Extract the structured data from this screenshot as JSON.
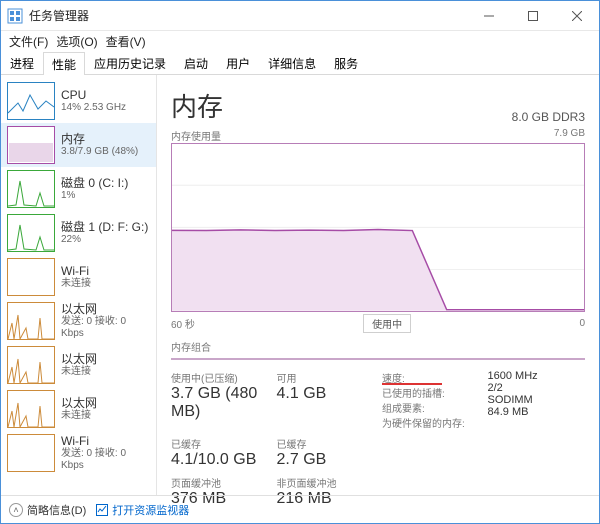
{
  "window": {
    "title": "任务管理器"
  },
  "menu": {
    "file": "文件(F)",
    "options": "选项(O)",
    "view": "查看(V)"
  },
  "tabs": [
    "进程",
    "性能",
    "应用历史记录",
    "启动",
    "用户",
    "详细信息",
    "服务"
  ],
  "active_tab": 1,
  "sidebar": {
    "items": [
      {
        "label": "CPU",
        "sub": "14% 2.53 GHz",
        "kind": "cpu"
      },
      {
        "label": "内存",
        "sub": "3.8/7.9 GB (48%)",
        "kind": "mem"
      },
      {
        "label": "磁盘 0 (C: I:)",
        "sub": "1%",
        "kind": "disk"
      },
      {
        "label": "磁盘 1 (D: F: G:)",
        "sub": "22%",
        "kind": "disk"
      },
      {
        "label": "Wi-Fi",
        "sub": "未连接",
        "kind": "wifi"
      },
      {
        "label": "以太网",
        "sub": "发送: 0 接收: 0 Kbps",
        "kind": "eth"
      },
      {
        "label": "以太网",
        "sub": "未连接",
        "kind": "eth"
      },
      {
        "label": "以太网",
        "sub": "未连接",
        "kind": "eth"
      },
      {
        "label": "Wi-Fi",
        "sub": "发送: 0 接收: 0 Kbps",
        "kind": "wifi"
      }
    ],
    "selected": 1
  },
  "memory": {
    "title": "内存",
    "total": "8.0 GB DDR3",
    "chart_title": "内存使用量",
    "chart_max": "7.9 GB",
    "time_label": "60 秒",
    "zero_label": "0",
    "mid_label": "使用中",
    "comp_title": "内存组合"
  },
  "stats": {
    "used_label": "使用中(已压缩)",
    "used_value": "3.7 GB (480 MB)",
    "avail_label": "可用",
    "avail_value": "4.1 GB",
    "commit_label": "已缓存",
    "commit_value": "4.1/10.0 GB",
    "cached_label": "已缓存",
    "cached_value": "2.7 GB",
    "paged_label": "页面缓冲池",
    "paged_value": "376 MB",
    "nonpaged_label": "非页面缓冲池",
    "nonpaged_value": "216 MB",
    "speed_label": "速度:",
    "speed_value": "1600 MHz",
    "slots_label": "已使用的插槽:",
    "slots_value": "2/2",
    "form_label": "组成要素:",
    "form_value": "SODIMM",
    "hw_label": "为硬件保留的内存:",
    "hw_value": "84.9 MB"
  },
  "footer": {
    "toggle": "简略信息(D)",
    "link": "打开资源监视器"
  },
  "chart_data": {
    "type": "area",
    "title": "内存使用量",
    "xlabel": "60 秒",
    "ylabel": "GB",
    "ylim": [
      0,
      7.9
    ],
    "x": [
      0,
      5,
      10,
      15,
      20,
      25,
      30,
      35,
      40,
      45,
      50,
      55,
      60
    ],
    "series": [
      {
        "name": "使用中",
        "values": [
          0.05,
          0.05,
          0.05,
          0.05,
          0.05,
          3.8,
          3.85,
          3.8,
          3.82,
          3.8,
          3.83,
          3.8,
          3.81
        ]
      }
    ]
  }
}
